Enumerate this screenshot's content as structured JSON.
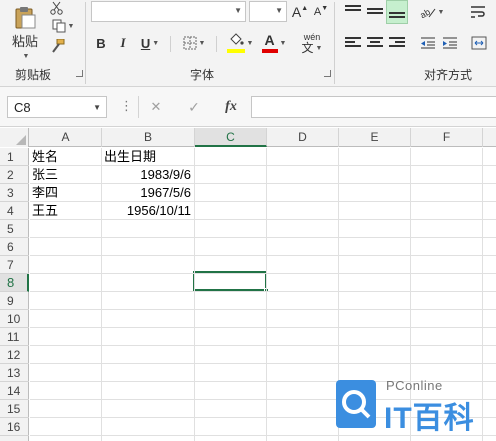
{
  "ribbon": {
    "clipboard": {
      "paste_label": "粘贴",
      "group_label": "剪贴板"
    },
    "font": {
      "group_label": "字体",
      "bold_label": "B",
      "italic_label": "I",
      "underline_label": "U",
      "grow_label": "A",
      "shrink_label": "A",
      "font_color_label": "A",
      "phonetic_top": "wén",
      "phonetic_bottom": "文",
      "fill_color": "#ffff00",
      "font_color": "#ff0000"
    },
    "alignment": {
      "group_label": "对齐方式",
      "active_fill": "#c6efce"
    }
  },
  "formula_bar": {
    "name_box_value": "C8",
    "cancel_icon": "✕",
    "enter_icon": "✓",
    "fx_label": "fx",
    "formula_value": ""
  },
  "columns": [
    "A",
    "B",
    "C",
    "D",
    "E",
    "F"
  ],
  "active_column": "C",
  "rows": [
    "1",
    "2",
    "3",
    "4",
    "5",
    "6",
    "7",
    "8",
    "9",
    "10",
    "11",
    "12",
    "13",
    "14",
    "15",
    "16"
  ],
  "active_row": "8",
  "sheet": {
    "header": {
      "a": "姓名",
      "b": "出生日期"
    },
    "records": [
      {
        "name": "张三",
        "birth": "1983/9/6"
      },
      {
        "name": "李四",
        "birth": "1967/5/6"
      },
      {
        "name": "王五",
        "birth": "1956/10/11"
      }
    ]
  },
  "watermark": {
    "small": "PConline",
    "large": "IT百科"
  },
  "colors": {
    "accent": "#217346",
    "watermark": "#3b8ee0"
  }
}
